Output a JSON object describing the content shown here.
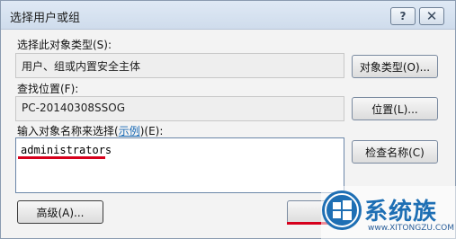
{
  "dialog": {
    "title": "选择用户或组",
    "help_label": "?",
    "close_label": "✕"
  },
  "object_type": {
    "label": "选择此对象类型(S):",
    "value": "用户、组或内置安全主体",
    "button_label": "对象类型(O)..."
  },
  "location": {
    "label": "查找位置(F):",
    "value": "PC-20140308SSOG",
    "button_label": "位置(L)..."
  },
  "names": {
    "label_prefix": "输入对象名称来选择(",
    "label_link": "示例",
    "label_suffix": ")(E):",
    "value": "administrators",
    "check_button_label": "检查名称(C)"
  },
  "footer": {
    "advanced_label": "高级(A)..."
  },
  "watermark": {
    "brand": "系统族",
    "url": "www.XITONGZU.COM"
  },
  "colors": {
    "highlight_red": "#d6001c",
    "brand_blue": "#1e6fb4"
  }
}
